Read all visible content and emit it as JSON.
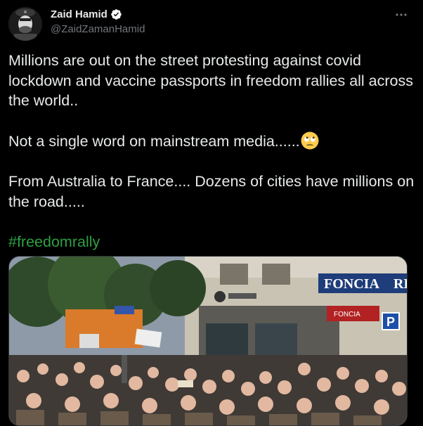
{
  "author": {
    "display_name": "Zaid Hamid",
    "handle": "@ZaidZamanHamid",
    "verified": true
  },
  "tweet": {
    "line1": "Millions are out on the street protesting against covid lockdown and vaccine passports in freedom rallies all across the world..",
    "line2": "Not a single word on mainstream media......",
    "line2_emoji": "face-with-rolling-eyes",
    "line3": "From Australia to France.... Dozens of cities have millions on the road.....",
    "hashtag": "#freedomrally"
  },
  "media": {
    "sign_left": "FONCIA",
    "sign_right": "RE",
    "sign_lower": "FONCIA",
    "parking": "P"
  },
  "icons": {
    "more": "more-icon",
    "verified": "verified-badge-icon"
  },
  "colors": {
    "background": "#000000",
    "text": "#e7e9ea",
    "secondary": "#71767b",
    "hashtag": "#2ea043",
    "verified": "#ffffff"
  }
}
